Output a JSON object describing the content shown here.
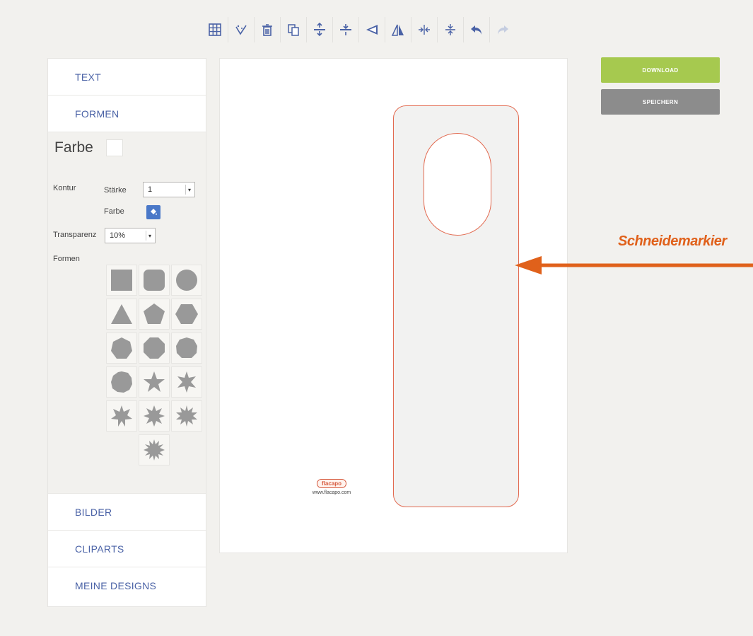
{
  "toolbar": {
    "icons": [
      "grid-icon",
      "magic-wand-icon",
      "trash-icon",
      "copy-icon",
      "align-top-icon",
      "align-middle-icon",
      "flip-horizontal-icon",
      "flip-vertical-icon",
      "center-horizontal-icon",
      "center-vertical-icon",
      "undo-icon",
      "redo-icon"
    ],
    "accent_color": "#4a78c8"
  },
  "sidebar": {
    "sections": {
      "text": "TEXT",
      "formen": "FORMEN",
      "bilder": "BILDER",
      "cliparts": "CLIPARTS",
      "meine_designs": "MEINE DESIGNS"
    },
    "formen_panel": {
      "farbe_title": "Farbe",
      "kontur_label": "Kontur",
      "staerke_label": "Stärke",
      "staerke_value": "1",
      "kontur_farbe_label": "Farbe",
      "transparenz_label": "Transparenz",
      "transparenz_value": "10%",
      "formen_label": "Formen",
      "shapes": [
        "square",
        "rounded-square",
        "circle",
        "triangle",
        "pentagon",
        "hexagon",
        "heptagon",
        "octagon",
        "nonagon",
        "decagon",
        "star-5",
        "star-6",
        "star-7",
        "star-8",
        "star-9",
        "star-10"
      ]
    }
  },
  "canvas": {
    "logo_text": "flacapo",
    "logo_url": "www.flacapo.com",
    "cut_line_color": "#e26a50"
  },
  "buttons": {
    "download": "DOWNLOAD",
    "save": "SPEICHERN"
  },
  "annotation": {
    "text": "Schneidemarkier",
    "color": "#e0611b"
  }
}
